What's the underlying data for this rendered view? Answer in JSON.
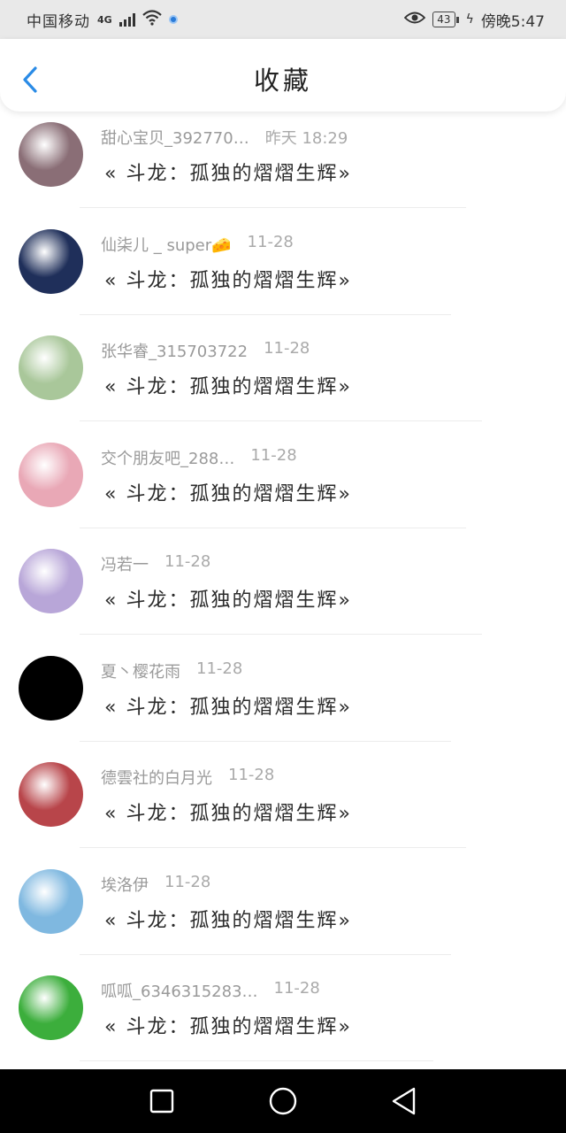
{
  "status_bar": {
    "carrier": "中国移动",
    "network": "4G",
    "battery": "43",
    "time": "傍晚5:47"
  },
  "header": {
    "title": "收藏",
    "back_icon": "chevron-left-icon"
  },
  "collections": [
    {
      "user": "甜心宝贝_392770…",
      "time": "昨天 18:29",
      "title": "« 斗龙：孤独的熠熠生辉»",
      "avatar_color": "#8a6e76"
    },
    {
      "user": "仙柒儿 _ super🧀",
      "time": "11-28",
      "title": "« 斗龙：孤独的熠熠生辉»",
      "avatar_color": "#1f2f5a"
    },
    {
      "user": "张华睿_315703722",
      "time": "11-28",
      "title": "« 斗龙：孤独的熠熠生辉»",
      "avatar_color": "#a9c79a"
    },
    {
      "user": "交个朋友吧_288…",
      "time": "11-28",
      "title": "« 斗龙：孤独的熠熠生辉»",
      "avatar_color": "#e9a8b6"
    },
    {
      "user": "冯若一",
      "time": "11-28",
      "title": "« 斗龙：孤独的熠熠生辉»",
      "avatar_color": "#b8a6d8"
    },
    {
      "user": "夏丶樱花雨",
      "time": "11-28",
      "title": "« 斗龙：孤独的熠熠生辉»",
      "avatar_color": "#000000"
    },
    {
      "user": "德雲社的白月光",
      "time": "11-28",
      "title": "« 斗龙：孤独的熠熠生辉»",
      "avatar_color": "#b8454a"
    },
    {
      "user": "埃洛伊",
      "time": "11-28",
      "title": "« 斗龙：孤独的熠熠生辉»",
      "avatar_color": "#7fb8e0"
    },
    {
      "user": "呱呱_6346315283…",
      "time": "11-28",
      "title": "« 斗龙：孤独的熠熠生辉»",
      "avatar_color": "#3cae3c"
    }
  ],
  "nav_bar": {
    "recent_icon": "square-icon",
    "home_icon": "circle-icon",
    "back_icon": "triangle-back-icon"
  }
}
